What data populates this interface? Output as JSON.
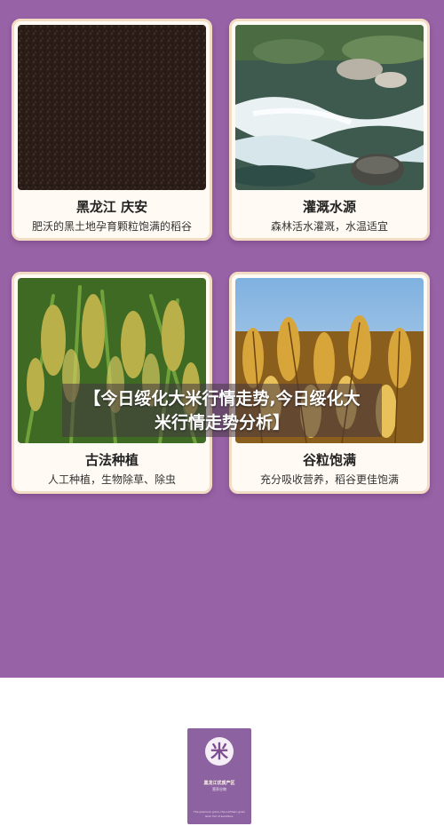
{
  "cards": [
    {
      "title": "黑龙江 庆安",
      "desc": "肥沃的黑土地孕育颗粒饱满的稻谷",
      "photo": "black-soil-photo"
    },
    {
      "title": "灌溉水源",
      "desc": "森林活水灌溉，水温适宜",
      "photo": "river-water-photo"
    },
    {
      "title": "古法种植",
      "desc": "人工种植，生物除草、除虫",
      "photo": "green-rice-photo"
    },
    {
      "title": "谷粒饱满",
      "desc": "充分吸收营养，稻谷更佳饱满",
      "photo": "golden-rice-photo"
    }
  ],
  "overlay": {
    "line1": "【今日绥化大米行情走势,今日绥化大",
    "line2": "米行情走势分析】"
  },
  "thumbnail": {
    "logo_char": "米",
    "line1": "黑龙江优质产区",
    "line2": "营养谷物",
    "fine_print": "The premium grain, the northern grain land, full of sunshine."
  },
  "colors": {
    "panel": "#9863a6",
    "card_border": "#f3dcc4",
    "card_bg": "#fffaf3"
  }
}
